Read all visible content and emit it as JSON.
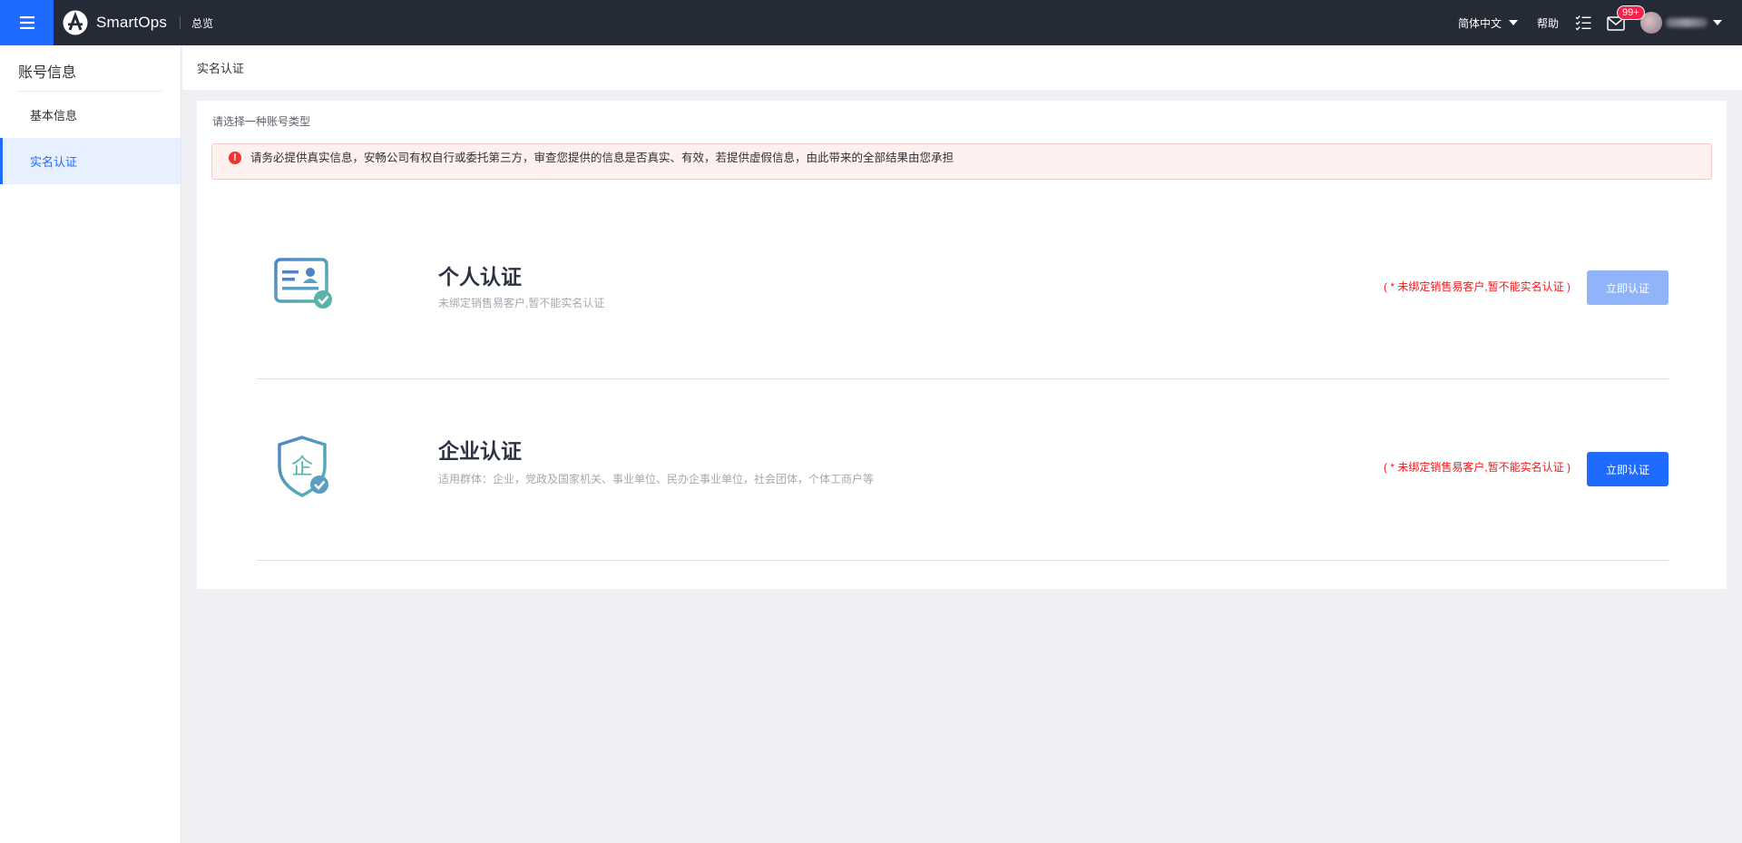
{
  "topbar": {
    "brand_name": "SmartOps",
    "overview": "总览",
    "language": "简体中文",
    "help": "帮助",
    "mail_badge": "99+"
  },
  "sidebar": {
    "title": "账号信息",
    "items": [
      {
        "label": "基本信息",
        "active": false
      },
      {
        "label": "实名认证",
        "active": true
      }
    ]
  },
  "page": {
    "header_title": "实名认证",
    "hint": "请选择一种账号类型",
    "alert_text": "请务必提供真实信息，安畅公司有权自行或委托第三方，审查您提供的信息是否真实、有效，若提供虚假信息，由此带来的全部结果由您承担"
  },
  "auth_options": [
    {
      "title": "个人认证",
      "desc": "未绑定销售易客户,暂不能实名认证",
      "warning": "( * 未绑定销售易客户,暂不能实名认证 )",
      "button": "立即认证",
      "button_state": "disabled",
      "icon": "id-card-icon"
    },
    {
      "title": "企业认证",
      "desc": "适用群体：企业，党政及国家机关、事业单位、民办企事业单位，社会团体，个体工商户等",
      "warning": "( * 未绑定销售易客户,暂不能实名认证 )",
      "button": "立即认证",
      "button_state": "enabled",
      "icon": "enterprise-shield-icon"
    }
  ],
  "colors": {
    "topbar": "#252a37",
    "accent": "#1f6bff",
    "warning_red": "#f01a1a"
  }
}
